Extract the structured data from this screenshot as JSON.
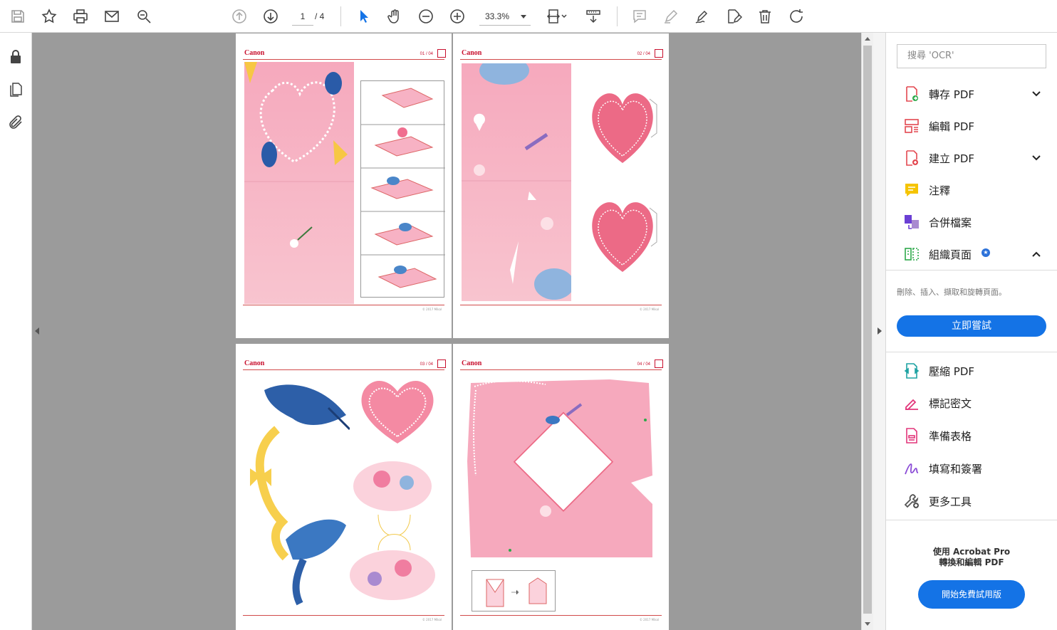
{
  "toolbar": {
    "page_current": "1",
    "page_total": "/ 4",
    "zoom": "33.3%"
  },
  "pages": [
    {
      "brand": "Canon",
      "num": "01 / 04",
      "foot": "© 2017 Mikal"
    },
    {
      "brand": "Canon",
      "num": "02 / 04",
      "foot": "© 2017 Mikal"
    },
    {
      "brand": "Canon",
      "num": "03 / 04",
      "foot": "© 2017 Mikal"
    },
    {
      "brand": "Canon",
      "num": "04 / 04",
      "foot": "© 2017 Mikal"
    }
  ],
  "right_panel": {
    "search_placeholder": "搜尋 'OCR'",
    "tools_top": [
      {
        "label": "轉存 PDF",
        "icon": "export-pdf-icon",
        "color": "#e34850"
      },
      {
        "label": "編輯 PDF",
        "icon": "edit-pdf-icon",
        "color": "#e34850"
      },
      {
        "label": "建立 PDF",
        "icon": "create-pdf-icon",
        "color": "#e34850"
      },
      {
        "label": "注釋",
        "icon": "comment-icon",
        "color": "#f5c400"
      },
      {
        "label": "合併檔案",
        "icon": "combine-files-icon",
        "color": "#6b3fd4"
      },
      {
        "label": "組織頁面",
        "icon": "organize-pages-icon",
        "color": "#2da84a"
      }
    ],
    "organize_desc": "刪除、插入、擷取和旋轉頁面。",
    "try_now": "立即嘗試",
    "tools_bottom": [
      {
        "label": "壓縮 PDF",
        "icon": "compress-pdf-icon",
        "color": "#1fa3a3"
      },
      {
        "label": "標記密文",
        "icon": "redact-icon",
        "color": "#e2357a"
      },
      {
        "label": "準備表格",
        "icon": "prepare-form-icon",
        "color": "#e2357a"
      },
      {
        "label": "填寫和簽署",
        "icon": "fill-sign-icon",
        "color": "#8a4bd6"
      },
      {
        "label": "更多工具",
        "icon": "more-tools-icon",
        "color": "#555555"
      }
    ],
    "promo_line1": "使用 Acrobat Pro",
    "promo_line2": "轉換和編輯 PDF",
    "trial_button": "開始免費試用版"
  }
}
